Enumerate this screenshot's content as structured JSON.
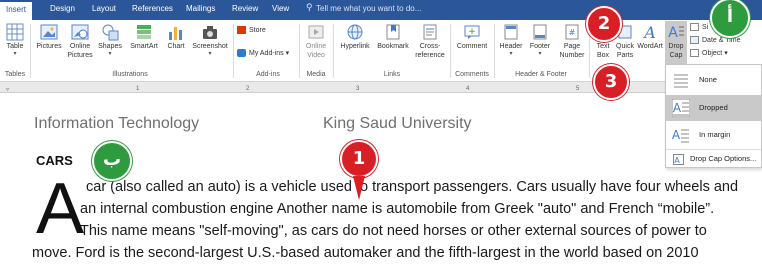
{
  "tabs": [
    {
      "label": "Insert",
      "active": true
    },
    {
      "label": "Design"
    },
    {
      "label": "Layout"
    },
    {
      "label": "References"
    },
    {
      "label": "Mailings"
    },
    {
      "label": "Review"
    },
    {
      "label": "View"
    }
  ],
  "tell_me": "Tell me what you want to do...",
  "ribbon": {
    "buttons": {
      "table": "Table",
      "pictures": "Pictures",
      "online_pictures_1": "Online",
      "online_pictures_2": "Pictures",
      "shapes": "Shapes",
      "smartart": "SmartArt",
      "chart": "Chart",
      "screenshot": "Screenshot",
      "store": "Store",
      "my_addins": "My Add-ins",
      "online_video_1": "Online",
      "online_video_2": "Video",
      "hyperlink": "Hyperlink",
      "bookmark": "Bookmark",
      "cross_ref_1": "Cross-",
      "cross_ref_2": "reference",
      "comment": "Comment",
      "header": "Header",
      "footer": "Footer",
      "page_number_1": "Page",
      "page_number_2": "Number",
      "text_box_1": "Text",
      "text_box_2": "Box",
      "quick_parts_1": "Quick",
      "quick_parts_2": "Parts",
      "wordart": "WordArt",
      "drop_cap_1": "Drop",
      "drop_cap_2": "Cap",
      "signature_line": "Si",
      "date_time": "Date & Time",
      "object": "Object"
    },
    "groups": {
      "tables": "Tables",
      "illustrations": "Illustrations",
      "addins": "Add-ins",
      "media": "Media",
      "links": "Links",
      "comments": "Comments",
      "header_footer": "Header & Footer"
    }
  },
  "ruler": {
    "marks": [
      "1",
      "2",
      "3",
      "4",
      "5"
    ]
  },
  "document": {
    "header_left": "Information Technology",
    "header_right": "King Saud University",
    "heading": "CARS",
    "drop_cap": "A",
    "lines": [
      "car (also called an auto) is a vehicle used to transport passengers. Cars usually have four wheels and",
      "an internal combustion engine Another name is automobile from Greek \"auto\" and French “mobile”.",
      "This name means \"self-moving\", as cars do not need horses or other external sources of power to",
      "move. Ford is the second-largest U.S.-based automaker and the fifth-largest in the world based on 2010"
    ]
  },
  "dropcap_menu": {
    "items": [
      {
        "label": "None",
        "selected": false
      },
      {
        "label": "Dropped",
        "selected": true
      },
      {
        "label": "In margin",
        "selected": false
      }
    ],
    "options_label": "Drop Cap Options..."
  },
  "annotations": {
    "badge_1": "1",
    "badge_2": "2",
    "badge_3": "3",
    "badge_alef": "أ",
    "badge_ba": "ب"
  },
  "colors": {
    "accent_blue": "#2b579a",
    "badge_red": "#d81f26",
    "badge_green": "#2e9b3f",
    "selected_item": "#c9c9c9"
  }
}
